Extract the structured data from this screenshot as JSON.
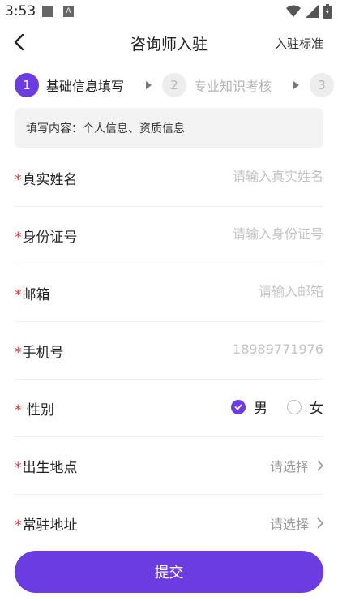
{
  "status_bar": {
    "time": "3:53",
    "notif_icon_text": "A"
  },
  "app_bar": {
    "title": "咨询师入驻",
    "right_link": "入驻标准"
  },
  "steps": [
    {
      "number": "1",
      "label": "基础信息填写",
      "state": "active"
    },
    {
      "number": "2",
      "label": "专业知识考核",
      "state": "inactive"
    },
    {
      "number": "3",
      "label": "",
      "state": "inactive"
    }
  ],
  "info": {
    "text": "填写内容：个人信息、资质信息"
  },
  "form": {
    "required_mark": "*",
    "real_name": {
      "label": "真实姓名",
      "placeholder": "请输入真实姓名",
      "value": ""
    },
    "id_number": {
      "label": "身份证号",
      "placeholder": "请输入身份证号",
      "value": ""
    },
    "email": {
      "label": "邮箱",
      "placeholder": "请输入邮箱",
      "value": ""
    },
    "phone": {
      "label": "手机号",
      "placeholder": "18989771976",
      "value": ""
    },
    "gender": {
      "label": " 性别",
      "options": [
        "男",
        "女"
      ],
      "selected": "男"
    },
    "birthplace": {
      "label": "出生地点",
      "value": "请选择"
    },
    "address": {
      "label": "常驻地址",
      "value": "请选择"
    }
  },
  "submit_label": "提交",
  "colors": {
    "accent": "#6c3ce3",
    "required": "#e03131",
    "placeholder": "#c4c4c4"
  }
}
